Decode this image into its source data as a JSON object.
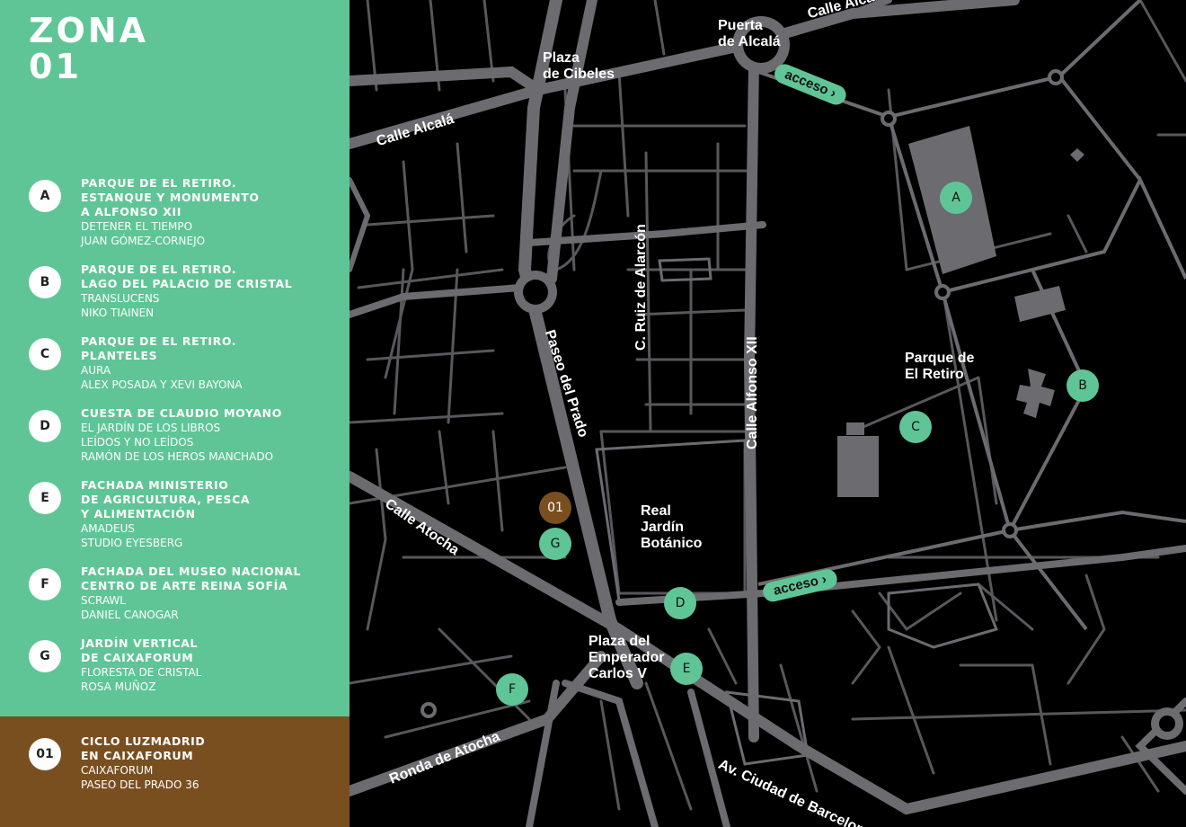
{
  "zone": {
    "line1": "ZONA",
    "line2": "01"
  },
  "items": [
    {
      "badge": "A",
      "title": [
        "PARQUE DE EL RETIRO.",
        "ESTANQUE Y MONUMENTO",
        "A ALFONSO XII"
      ],
      "sub": [
        "DETENER EL TIEMPO",
        "JUAN GÓMEZ-CORNEJO"
      ]
    },
    {
      "badge": "B",
      "title": [
        "PARQUE DE EL RETIRO.",
        "LAGO DEL PALACIO DE CRISTAL"
      ],
      "sub": [
        "TRANSLUCENS",
        "NIKO TIAINEN"
      ]
    },
    {
      "badge": "C",
      "title": [
        "PARQUE DE EL RETIRO.",
        "PLANTELES"
      ],
      "sub": [
        "AURA",
        "ALEX POSADA Y XEVI BAYONA"
      ]
    },
    {
      "badge": "D",
      "title": [
        "CUESTA DE CLAUDIO MOYANO"
      ],
      "sub": [
        "EL JARDÍN DE LOS LIBROS",
        "LEÍDOS Y NO LEÍDOS",
        "RAMÓN DE LOS HEROS MANCHADO"
      ]
    },
    {
      "badge": "E",
      "title": [
        "FACHADA MINISTERIO",
        "DE AGRICULTURA, PESCA",
        "Y ALIMENTACIÓN"
      ],
      "sub": [
        "AMADEUS",
        "STUDIO EYESBERG"
      ]
    },
    {
      "badge": "F",
      "title": [
        "FACHADA DEL MUSEO NACIONAL",
        "CENTRO DE ARTE REINA SOFÍA"
      ],
      "sub": [
        "SCRAWL",
        "DANIEL CANOGAR"
      ]
    },
    {
      "badge": "G",
      "title": [
        "JARDÍN VERTICAL",
        "DE CAIXAFORUM"
      ],
      "sub": [
        "FLORESTA DE CRISTAL",
        "ROSA MUÑOZ"
      ]
    }
  ],
  "featured": {
    "badge": "01",
    "title": [
      "CICLO LUZMADRID",
      "EN CAIXAFORUM"
    ],
    "sub": [
      "CAIXAFORUM",
      "PASEO DEL PRADO 36"
    ]
  },
  "map": {
    "streets": {
      "calle_alcala_top": "Calle Alcalá",
      "calle_alcala_left": "Calle Alcalá",
      "paseo_prado": "Paseo del Prado",
      "ruiz_alarcon": "C. Ruiz de Alarcón",
      "alfonso_xii": "Calle Alfonso XII",
      "calle_atocha": "Calle Atocha",
      "ronda_atocha": "Ronda de Atocha",
      "ciudad_barcelona": "Av. Ciudad de Barcelona"
    },
    "places": {
      "puerta_alcala": [
        "Puerta",
        "de Alcalá"
      ],
      "plaza_cibeles": [
        "Plaza",
        "de Cibeles"
      ],
      "parque_retiro": [
        "Parque de",
        "El Retiro"
      ],
      "jardin_botanico": [
        "Real",
        "Jardín",
        "Botánico"
      ],
      "plaza_emperador": [
        "Plaza del",
        "Emperador",
        "Carlos V"
      ]
    },
    "access": {
      "label": "acceso",
      "arrow": "›"
    },
    "pins": {
      "A": "A",
      "B": "B",
      "C": "C",
      "D": "D",
      "E": "E",
      "F": "F",
      "G": "G",
      "o1": "01"
    },
    "colors": {
      "land": "#000000",
      "road": "#6b6b70",
      "minor_road": "#58585c",
      "pin": "#5fc596",
      "featured": "#7a4f20"
    }
  }
}
